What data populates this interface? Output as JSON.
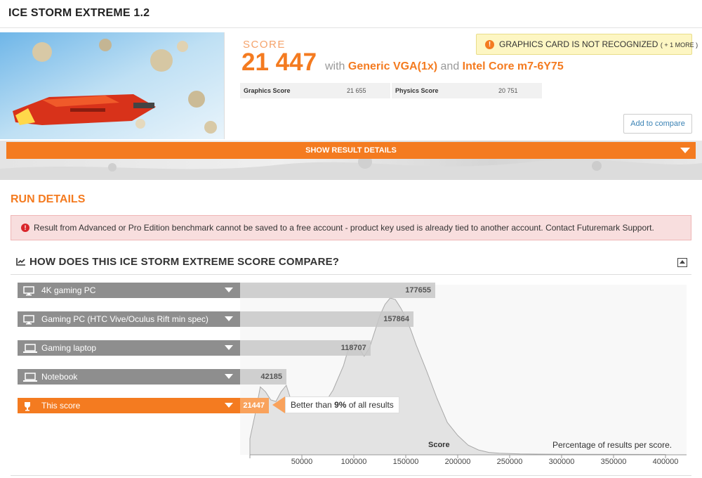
{
  "header": {
    "title": "ICE STORM EXTREME 1.2"
  },
  "result": {
    "score_label": "SCORE",
    "score_value": "21 447",
    "with_text": "with",
    "gpu": "Generic VGA(1x)",
    "and_text": "and",
    "cpu": "Intel Core m7-6Y75",
    "subscores": [
      {
        "label": "Graphics Score",
        "value": "21 655"
      },
      {
        "label": "Physics Score",
        "value": "20 751"
      }
    ],
    "warning_text": "GRAPHICS CARD IS NOT RECOGNIZED",
    "warning_more": "( + 1 MORE )",
    "warning_icon": "exclamation-icon",
    "add_to_compare": "Add to compare"
  },
  "details_bar": {
    "label": "SHOW RESULT DETAILS",
    "icon": "chevron-down-icon"
  },
  "run_details": {
    "title": "RUN DETAILS",
    "error_text": "Result from Advanced or Pro Edition benchmark cannot be saved to a free account - product key used is already tied to another account. Contact Futuremark Support.",
    "error_icon": "exclamation-circle-icon"
  },
  "compare": {
    "title": "HOW DOES THIS ICE STORM EXTREME SCORE COMPARE?",
    "icon": "line-chart-icon",
    "collapse_icon": "collapse-up-icon",
    "callout_prefix": "Better than",
    "callout_pct": "9%",
    "callout_suffix": "of all results",
    "score_axis_label": "Score",
    "percentage_label": "Percentage of results per score."
  },
  "colors": {
    "accent": "#f47b20",
    "bar_gray": "#8e8e8e",
    "warning_bg": "#fdf6c3",
    "error_bg": "#f8dede",
    "link": "#3a82b4"
  },
  "chart_data": {
    "type": "bar",
    "categories": [
      "4K gaming PC",
      "Gaming PC (HTC Vive/Oculus Rift min spec)",
      "Gaming laptop",
      "Notebook",
      "This score"
    ],
    "values": [
      177655,
      157864,
      118707,
      42185,
      21447
    ],
    "highlight": "This score",
    "device_icons": [
      "monitor-icon",
      "monitor-icon",
      "laptop-icon",
      "laptop-icon",
      "trophy-icon"
    ],
    "xlim": [
      0,
      400000
    ],
    "x_ticks": [
      50000,
      100000,
      150000,
      200000,
      250000,
      300000,
      350000,
      400000
    ],
    "distribution": {
      "type": "area",
      "x": [
        0,
        5000,
        10000,
        15000,
        20000,
        25000,
        30000,
        35000,
        40000,
        45000,
        50000,
        60000,
        70000,
        80000,
        90000,
        95000,
        100000,
        105000,
        110000,
        115000,
        120000,
        125000,
        130000,
        135000,
        140000,
        145000,
        150000,
        155000,
        160000,
        170000,
        180000,
        190000,
        200000,
        210000,
        220000,
        230000,
        240000,
        260000,
        300000,
        400000
      ],
      "y": [
        0.1,
        0.25,
        0.42,
        0.39,
        0.34,
        0.33,
        0.39,
        0.43,
        0.33,
        0.27,
        0.26,
        0.26,
        0.3,
        0.4,
        0.55,
        0.66,
        0.7,
        0.66,
        0.61,
        0.66,
        0.76,
        0.86,
        0.93,
        0.97,
        0.96,
        0.91,
        0.85,
        0.77,
        0.68,
        0.52,
        0.35,
        0.2,
        0.12,
        0.06,
        0.03,
        0.015,
        0.01,
        0.005,
        0.003,
        0.002
      ]
    }
  }
}
